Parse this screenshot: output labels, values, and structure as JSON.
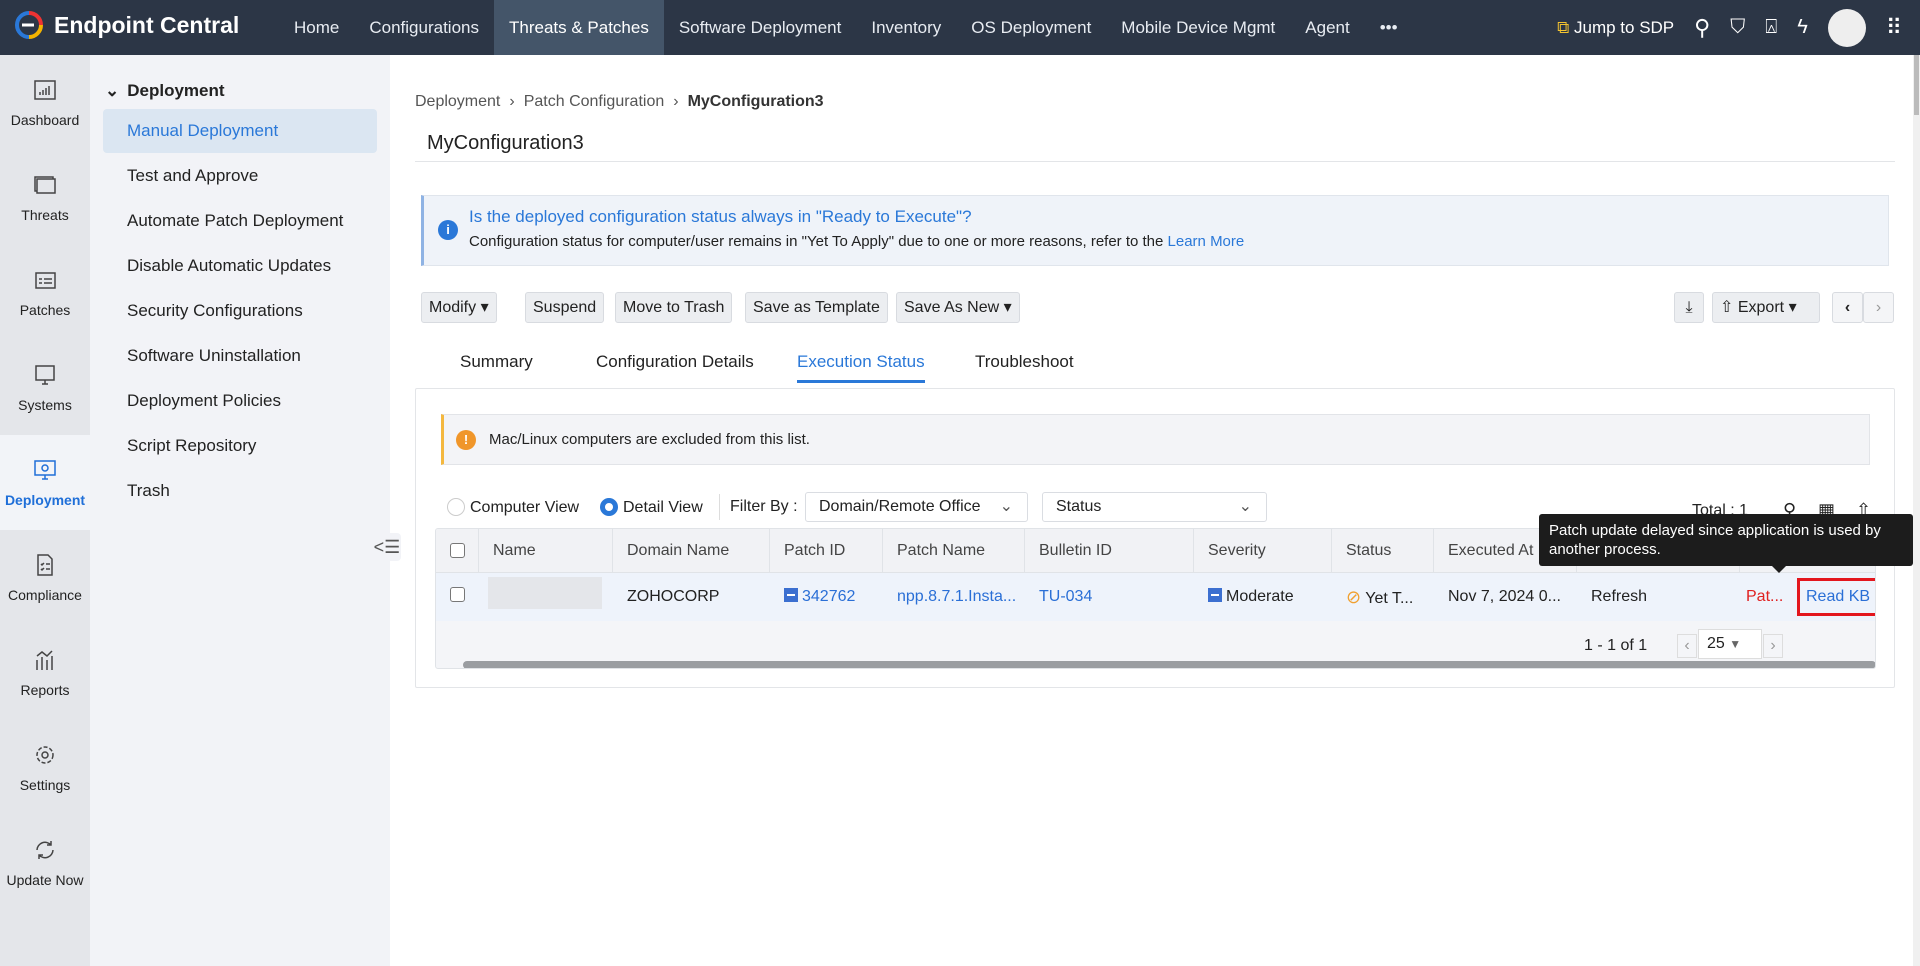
{
  "app": {
    "title": "Endpoint Central"
  },
  "nav": [
    "Home",
    "Configurations",
    "Threats & Patches",
    "Software Deployment",
    "Inventory",
    "OS Deployment",
    "Mobile Device Mgmt",
    "Agent",
    "•••"
  ],
  "topright": {
    "jump": "Jump to SDP"
  },
  "rail": [
    "Dashboard",
    "Threats",
    "Patches",
    "Systems",
    "Deployment",
    "Compliance",
    "Reports",
    "Settings",
    "Update Now"
  ],
  "side": {
    "header": "Deployment",
    "items": [
      "Manual Deployment",
      "Test and Approve",
      "Automate Patch Deployment",
      "Disable Automatic Updates",
      "Security Configurations",
      "Software Uninstallation",
      "Deployment Policies",
      "Script Repository",
      "Trash"
    ]
  },
  "breadcrumb": [
    "Deployment",
    "Patch Configuration",
    "MyConfiguration3"
  ],
  "page_title": "MyConfiguration3",
  "info": {
    "question": "Is the deployed configuration status always in \"Ready to Execute\"?",
    "desc": "Configuration status for computer/user remains in \"Yet To Apply\" due to one or more reasons, refer to the ",
    "link": "Learn More"
  },
  "toolbar": {
    "modify": "Modify",
    "suspend": "Suspend",
    "trash": "Move to Trash",
    "template": "Save as Template",
    "save_new": "Save As New",
    "export": "Export"
  },
  "tabs": [
    "Summary",
    "Configuration Details",
    "Execution Status",
    "Troubleshoot"
  ],
  "warning": "Mac/Linux computers are excluded from this list.",
  "filters": {
    "computer_view": "Computer View",
    "detail_view": "Detail View",
    "filter_by": "Filter By :",
    "domain": "Domain/Remote Office",
    "status": "Status",
    "total": "Total : 1"
  },
  "table": {
    "columns": [
      "Name",
      "Domain Name",
      "Patch ID",
      "Patch Name",
      "Bulletin ID",
      "Severity",
      "Status",
      "Executed At",
      "",
      ""
    ],
    "row": {
      "name": "",
      "domain": "ZOHOCORP",
      "patch_id": "342762",
      "patch_name": "npp.8.7.1.Insta...",
      "bulletin": "TU-034",
      "severity": "Moderate",
      "status": "Yet T...",
      "executed": "Nov 7, 2024 0...",
      "remarks": "Refresh",
      "error": "Pat...",
      "kb": "Read KB"
    }
  },
  "pagination": {
    "range": "1 - 1 of 1",
    "per_page": "25"
  },
  "tooltip": "Patch update delayed since application is used by another process."
}
